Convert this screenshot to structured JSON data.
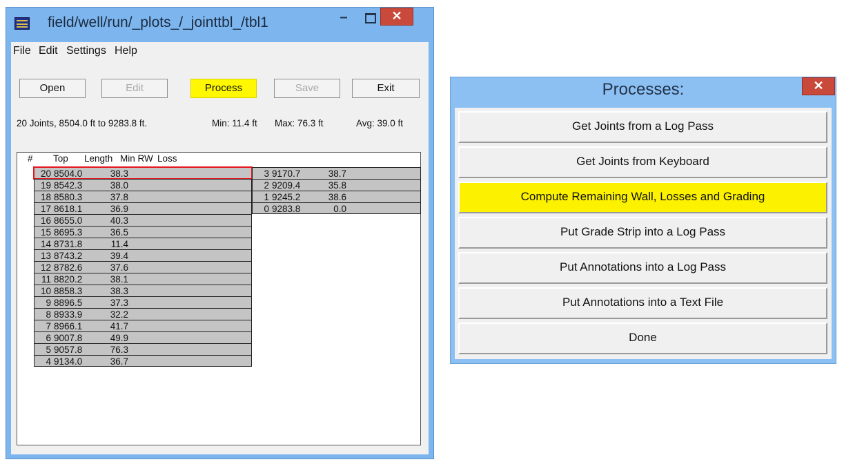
{
  "window": {
    "title": "field/well/run/_plots_/_jointtbl_/tbl1",
    "minimize": "–",
    "close": "✕",
    "menu": [
      "File",
      "Edit",
      "Settings",
      "Help"
    ],
    "buttons": {
      "open": "Open",
      "edit": "Edit",
      "process": "Process",
      "save": "Save",
      "exit": "Exit"
    },
    "summary": {
      "range": "20 Joints,  8504.0 ft to 9283.8 ft.",
      "min": "Min: 11.4 ft",
      "max": "Max: 76.3 ft",
      "avg": "Avg: 39.0 ft"
    },
    "table": {
      "headers": [
        "#",
        "Top",
        "Length",
        "Min RW",
        "Loss"
      ],
      "left_rows": [
        {
          "num": "20",
          "top": "8504.0",
          "len": "38.3"
        },
        {
          "num": "19",
          "top": "8542.3",
          "len": "38.0"
        },
        {
          "num": "18",
          "top": "8580.3",
          "len": "37.8"
        },
        {
          "num": "17",
          "top": "8618.1",
          "len": "36.9"
        },
        {
          "num": "16",
          "top": "8655.0",
          "len": "40.3"
        },
        {
          "num": "15",
          "top": "8695.3",
          "len": "36.5"
        },
        {
          "num": "14",
          "top": "8731.8",
          "len": "11.4"
        },
        {
          "num": "13",
          "top": "8743.2",
          "len": "39.4"
        },
        {
          "num": "12",
          "top": "8782.6",
          "len": "37.6"
        },
        {
          "num": "11",
          "top": "8820.2",
          "len": "38.1"
        },
        {
          "num": "10",
          "top": "8858.3",
          "len": "38.3"
        },
        {
          "num": "9",
          "top": "8896.5",
          "len": "37.3"
        },
        {
          "num": "8",
          "top": "8933.9",
          "len": "32.2"
        },
        {
          "num": "7",
          "top": "8966.1",
          "len": "41.7"
        },
        {
          "num": "6",
          "top": "9007.8",
          "len": "49.9"
        },
        {
          "num": "5",
          "top": "9057.8",
          "len": "76.3"
        },
        {
          "num": "4",
          "top": "9134.0",
          "len": "36.7"
        }
      ],
      "right_rows": [
        {
          "num": "3",
          "top": "9170.7",
          "len": "38.7"
        },
        {
          "num": "2",
          "top": "9209.4",
          "len": "35.8"
        },
        {
          "num": "1",
          "top": "9245.2",
          "len": "38.6"
        },
        {
          "num": "0",
          "top": "9283.8",
          "len": "0.0"
        }
      ]
    }
  },
  "processes": {
    "title": "Processes:",
    "close": "✕",
    "buttons": [
      "Get Joints from a Log Pass",
      "Get Joints from Keyboard",
      "Compute Remaining Wall, Losses and Grading",
      "Put Grade Strip into a Log Pass",
      "Put Annotations into a Log Pass",
      "Put Annotations into a Text File",
      "Done"
    ]
  },
  "highlight_color": "#fff800",
  "selection_color": "#e2141e"
}
